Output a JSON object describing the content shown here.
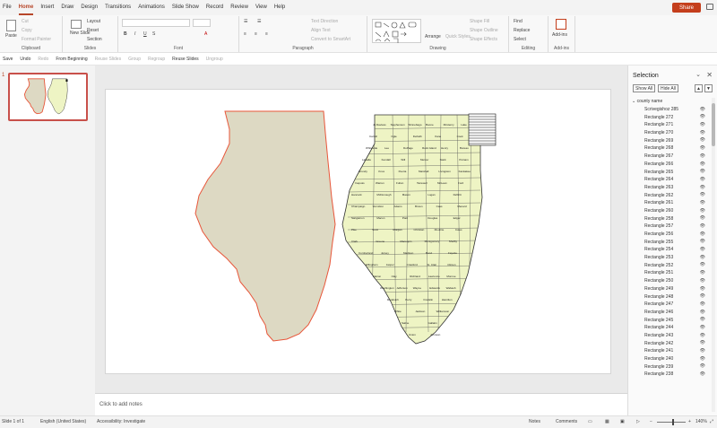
{
  "menu": {
    "tabs": [
      "File",
      "Home",
      "Insert",
      "Draw",
      "Design",
      "Transitions",
      "Animations",
      "Slide Show",
      "Record",
      "Review",
      "View",
      "Help"
    ],
    "share_label": "Share"
  },
  "ribbon": {
    "clipboard": {
      "paste": "Paste",
      "cut": "Cut",
      "copy": "Copy",
      "format_painter": "Format Painter",
      "label": "Clipboard"
    },
    "slides": {
      "new_slide": "New Slide",
      "layout": "Layout",
      "reset": "Reset",
      "section": "Section",
      "label": "Slides"
    },
    "font": {
      "label": "Font"
    },
    "paragraph": {
      "text_direction": "Text Direction",
      "align_text": "Align Text",
      "convert_smartart": "Convert to SmartArt",
      "label": "Paragraph"
    },
    "drawing": {
      "arrange": "Arrange",
      "quick_styles": "Quick Styles",
      "shape_fill": "Shape Fill",
      "shape_outline": "Shape Outline",
      "shape_effects": "Shape Effects",
      "label": "Drawing"
    },
    "editing": {
      "find": "Find",
      "replace": "Replace",
      "select": "Select",
      "label": "Editing"
    },
    "addins": {
      "addins": "Add-ins",
      "label": "Add-ins"
    }
  },
  "qat": [
    "Save",
    "Undo",
    "Redo",
    "From Beginning",
    "Reuse Slides",
    "Group",
    "Regroup",
    "Reuse Slides",
    "Ungroup"
  ],
  "thumbs": {
    "slide_number": "1"
  },
  "notes": {
    "placeholder": "Click to add notes"
  },
  "selection_pane": {
    "title": "Selection",
    "show_all": "Show All",
    "hide_all": "Hide All",
    "group_name": "county name",
    "items": [
      "Scrivegishoz 285",
      "Rectangle 272",
      "Rectangle 271",
      "Rectangle 270",
      "Rectangle 269",
      "Rectangle 268",
      "Rectangle 267",
      "Rectangle 266",
      "Rectangle 265",
      "Rectangle 264",
      "Rectangle 263",
      "Rectangle 262",
      "Rectangle 261",
      "Rectangle 260",
      "Rectangle 258",
      "Rectangle 257",
      "Rectangle 256",
      "Rectangle 255",
      "Rectangle 254",
      "Rectangle 253",
      "Rectangle 252",
      "Rectangle 251",
      "Rectangle 250",
      "Rectangle 249",
      "Rectangle 248",
      "Rectangle 247",
      "Rectangle 246",
      "Rectangle 245",
      "Rectangle 244",
      "Rectangle 243",
      "Rectangle 242",
      "Rectangle 241",
      "Rectangle 240",
      "Rectangle 239",
      "Rectangle 238"
    ]
  },
  "status": {
    "slide": "Slide 1 of 1",
    "language": "English (United States)",
    "accessibility": "Accessibility: Investigate",
    "notes": "Notes",
    "comments": "Comments",
    "zoom": "140%"
  },
  "colors": {
    "accent": "#b7472a",
    "map_fill": "#ddd9c3",
    "map_outline": "#e8563a",
    "county_fill": "#eef4c4"
  },
  "counties": [
    "Jo Daviess",
    "Stephenson",
    "Winnebago",
    "Boone",
    "McHenry",
    "Lake",
    "Carroll",
    "Ogle",
    "DeKalb",
    "Kane",
    "Cook",
    "Whiteside",
    "Lee",
    "DuPage",
    "Rock Island",
    "Henry",
    "Bureau",
    "LaSalle",
    "Kendall",
    "Will",
    "Mercer",
    "Stark",
    "Putnam",
    "Grundy",
    "Knox",
    "Peoria",
    "Marshall",
    "Livingston",
    "Kankakee",
    "Iroquois",
    "Warren",
    "Fulton",
    "Tazewell",
    "McLean",
    "Ford",
    "Hancock",
    "McDonough",
    "Mason",
    "Logan",
    "DeWitt",
    "Champaign",
    "Vermilion",
    "Adams",
    "Brown",
    "Cass",
    "Menard",
    "Sangamon",
    "Macon",
    "Piatt",
    "Douglas",
    "Edgar",
    "Pike",
    "Scott",
    "Morgan",
    "Christian",
    "Moultrie",
    "Coles",
    "Clark",
    "Greene",
    "Macoupin",
    "Montgomery",
    "Shelby",
    "Cumberland",
    "Jersey",
    "Madison",
    "Bond",
    "Fayette",
    "Effingham",
    "Jasper",
    "Crawford",
    "St. Clair",
    "Clinton",
    "Marion",
    "Clay",
    "Richland",
    "Lawrence",
    "Monroe",
    "Washington",
    "Jefferson",
    "Wayne",
    "Edwards",
    "Wabash",
    "Randolph",
    "Perry",
    "Franklin",
    "Hamilton",
    "White",
    "Jackson",
    "Williamson",
    "Saline",
    "Gallatin",
    "Union",
    "Johnson",
    "Pope",
    "Hardin",
    "Alexander",
    "Pulaski",
    "Massac"
  ]
}
